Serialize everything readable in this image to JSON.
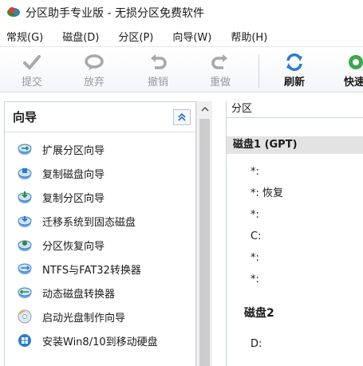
{
  "window": {
    "title": "分区助手专业版 - 无损分区免费软件"
  },
  "menu": {
    "items": [
      "常规(G)",
      "磁盘(D)",
      "分区(P)",
      "向导(W)",
      "帮助(H)"
    ]
  },
  "toolbar": {
    "commit": "提交",
    "discard": "放弃",
    "undo": "撤销",
    "redo": "重做",
    "refresh": "刷新",
    "quick": "快速"
  },
  "wizard_panel": {
    "title": "向导",
    "items": [
      {
        "label": "扩展分区向导",
        "icon": "extend-partition-icon"
      },
      {
        "label": "复制磁盘向导",
        "icon": "copy-disk-icon"
      },
      {
        "label": "复制分区向导",
        "icon": "copy-partition-icon"
      },
      {
        "label": "迁移系统到固态磁盘",
        "icon": "migrate-os-icon"
      },
      {
        "label": "分区恢复向导",
        "icon": "partition-recovery-icon"
      },
      {
        "label": "NTFS与FAT32转换器",
        "icon": "ntfs-fat32-converter-icon"
      },
      {
        "label": "动态磁盘转换器",
        "icon": "dynamic-disk-converter-icon"
      },
      {
        "label": "启动光盘制作向导",
        "icon": "bootable-media-icon"
      },
      {
        "label": "安装Win8/10到移动硬盘",
        "icon": "windows-to-go-icon"
      }
    ]
  },
  "partition_panel": {
    "header": "分区",
    "disk1": {
      "title": "磁盘1 (GPT)",
      "partitions": [
        "*:",
        "*: 恢复",
        "*:",
        "C:",
        "*:",
        "*:"
      ]
    },
    "disk2": {
      "title": "磁盘2",
      "partitions": [
        "D:"
      ]
    }
  },
  "colors": {
    "toolbar_disabled_text": "#9a9a9a",
    "panel_border": "#c9d3df",
    "disk_header_bg": "#e3e3e3",
    "accent_blue": "#2b7bd3"
  }
}
